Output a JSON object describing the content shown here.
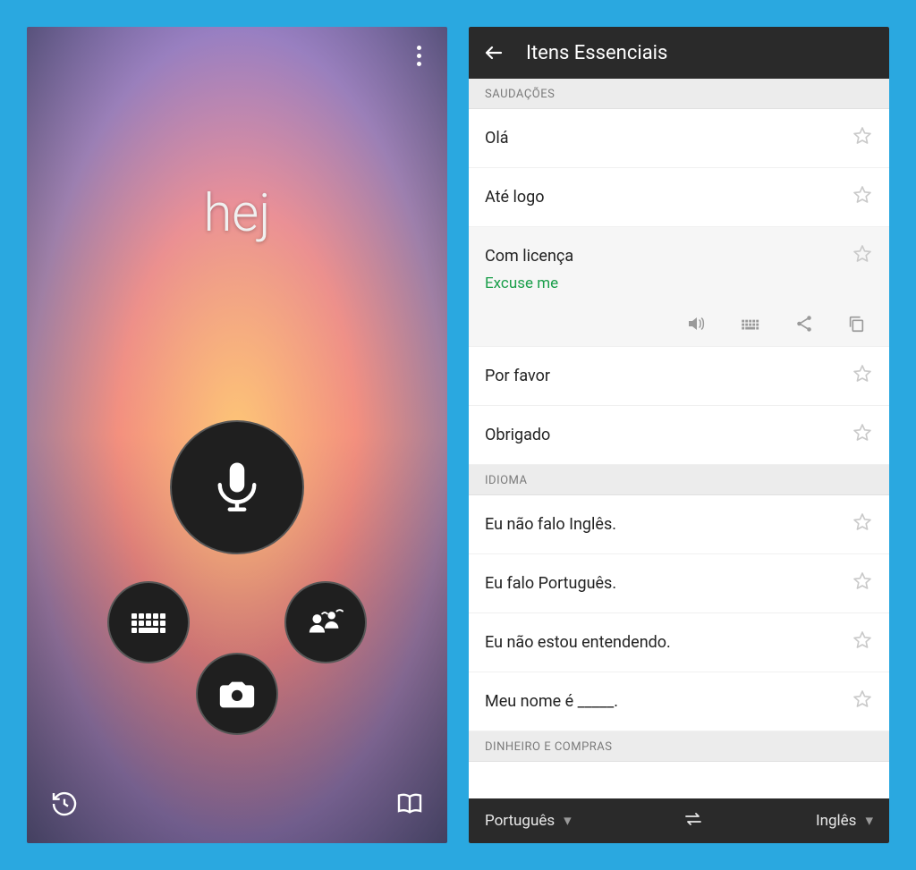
{
  "left": {
    "word": "hej"
  },
  "right": {
    "title": "Itens Essenciais",
    "sections": [
      {
        "header": "SAUDAÇÕES",
        "items": [
          {
            "text": "Olá"
          },
          {
            "text": "Até logo"
          },
          {
            "text": "Com licença",
            "translation": "Excuse me",
            "expanded": true
          },
          {
            "text": "Por favor"
          },
          {
            "text": "Obrigado"
          }
        ]
      },
      {
        "header": "IDIOMA",
        "items": [
          {
            "text": "Eu não falo Inglês."
          },
          {
            "text": "Eu falo Português."
          },
          {
            "text": "Eu não estou entendendo."
          },
          {
            "text": "Meu nome é _____."
          }
        ]
      },
      {
        "header": "DINHEIRO E COMPRAS",
        "items": []
      }
    ],
    "source_lang": "Português",
    "target_lang": "Inglês"
  }
}
